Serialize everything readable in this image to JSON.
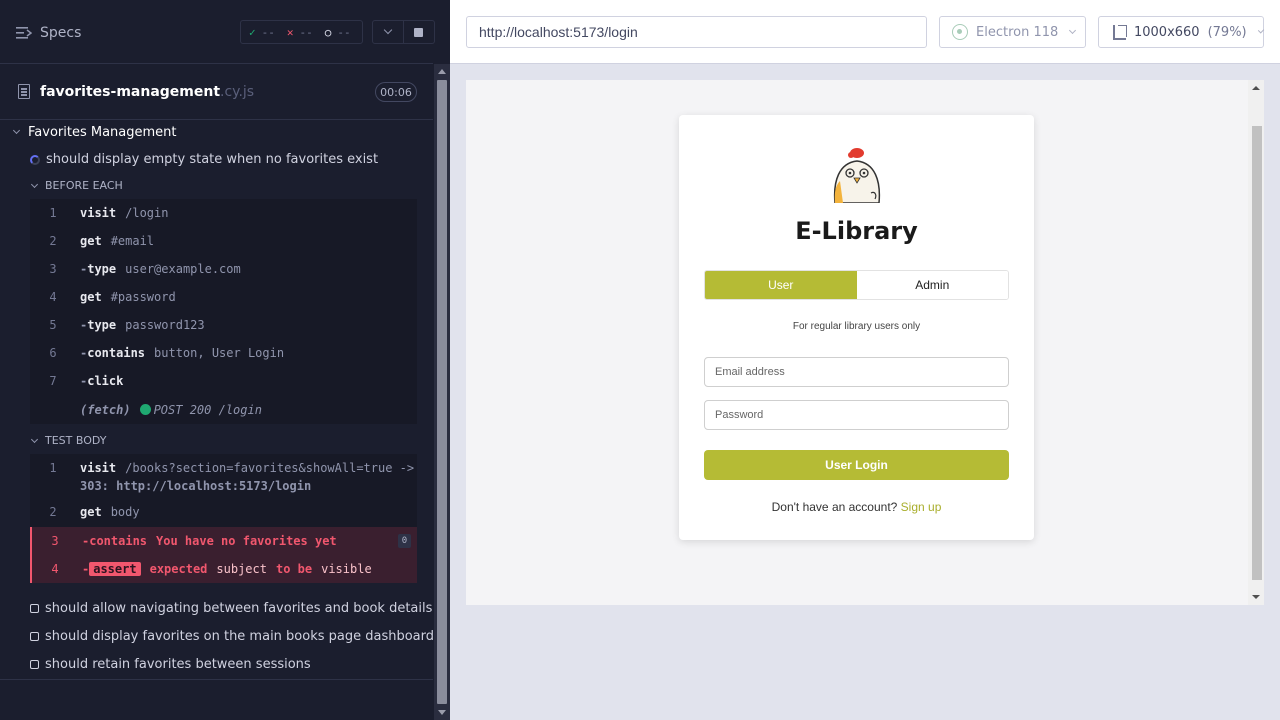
{
  "reporter": {
    "header": {
      "title": "Specs",
      "stats": {
        "passed": "--",
        "failed": "--",
        "pending": "--"
      }
    },
    "spec": {
      "name": "favorites-management",
      "ext": ".cy.js",
      "duration": "00:06"
    },
    "suite": {
      "title": "Favorites Management"
    },
    "running_test": {
      "title": "should display empty state when no favorites exist"
    },
    "before_each": {
      "title": "BEFORE EACH",
      "commands": [
        {
          "num": "1",
          "name": "visit",
          "msg": "/login"
        },
        {
          "num": "2",
          "name": "get",
          "msg": "#email"
        },
        {
          "num": "3",
          "name": "type",
          "msg": "user@example.com"
        },
        {
          "num": "4",
          "name": "get",
          "msg": "#password"
        },
        {
          "num": "5",
          "name": "type",
          "msg": "password123"
        },
        {
          "num": "6",
          "name": "contains",
          "msg": "button, User Login"
        },
        {
          "num": "7",
          "name": "click",
          "msg": ""
        },
        {
          "num": "",
          "name": "(fetch)",
          "msg": "POST 200 /login"
        }
      ]
    },
    "test_body": {
      "title": "TEST BODY",
      "commands": [
        {
          "num": "1",
          "name": "visit",
          "msg": "/books?section=favorites&showAll=true ->",
          "msg2": "303: http://localhost:5173/login"
        },
        {
          "num": "2",
          "name": "get",
          "msg": "body"
        },
        {
          "num": "3",
          "name": "contains",
          "msg": "You have no favorites yet",
          "badge": "0"
        },
        {
          "num": "4",
          "name": "assert",
          "msg_a": "expected",
          "msg_b": "subject",
          "msg_c": "to be",
          "msg_d": "visible"
        }
      ]
    },
    "pending_tests": [
      "should allow navigating between favorites and book details",
      "should display favorites on the main books page dashboard",
      "should retain favorites between sessions"
    ]
  },
  "preview": {
    "url": "http://localhost:5173/login",
    "browser": "Electron 118",
    "viewport": "1000x660",
    "viewport_display": "1000x660",
    "zoom": "(79%)"
  },
  "app": {
    "title": "E-Library",
    "role_tabs": [
      "User",
      "Admin"
    ],
    "role_note": "For regular library users only",
    "email_placeholder": "Email address",
    "password_placeholder": "Password",
    "login_button": "User Login",
    "signup_prompt": "Don't have an account?",
    "signup_link": "Sign up",
    "brand_color": "#b5bb35"
  }
}
